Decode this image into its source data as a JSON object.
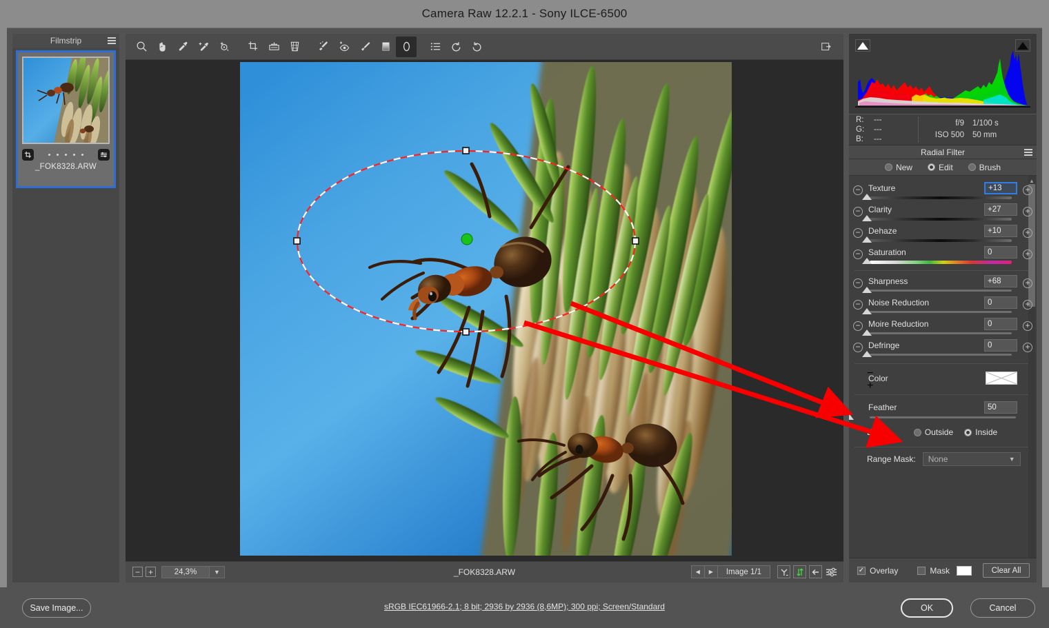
{
  "window": {
    "title": "Camera Raw 12.2.1  -  Sony ILCE-6500"
  },
  "filmstrip": {
    "title": "Filmstrip",
    "menu_icon": "hamburger-icon",
    "thumbnail_filename": "_FOK8328.ARW",
    "crop_badge_icon": "crop-badge-icon",
    "adjust_badge_icon": "adjustment-badge-icon"
  },
  "toolbar": {
    "tools": [
      {
        "name": "zoom-tool",
        "icon": "magnifier-icon",
        "active": false
      },
      {
        "name": "hand-tool",
        "icon": "hand-icon",
        "active": false
      },
      {
        "name": "white-balance-tool",
        "icon": "eyedropper-icon",
        "active": false
      },
      {
        "name": "color-sampler-tool",
        "icon": "color-sampler-icon",
        "active": false
      },
      {
        "name": "targeted-adjustment-tool",
        "icon": "targeted-adjustment-icon",
        "active": false
      },
      {
        "name": "crop-tool",
        "icon": "crop-icon",
        "active": false
      },
      {
        "name": "straighten-tool",
        "icon": "straighten-icon",
        "active": false
      },
      {
        "name": "transform-tool",
        "icon": "transform-grid-icon",
        "active": false
      },
      {
        "name": "spot-removal-tool",
        "icon": "spot-heal-icon",
        "active": false
      },
      {
        "name": "red-eye-tool",
        "icon": "red-eye-icon",
        "active": false
      },
      {
        "name": "adjustment-brush-tool",
        "icon": "brush-icon",
        "active": false
      },
      {
        "name": "graduated-filter-tool",
        "icon": "graduated-filter-icon",
        "active": false
      },
      {
        "name": "radial-filter-tool",
        "icon": "radial-filter-icon",
        "active": true
      },
      {
        "name": "presets-tool",
        "icon": "presets-list-icon",
        "active": false
      },
      {
        "name": "rotate-ccw-tool",
        "icon": "rotate-counterclockwise-icon",
        "active": false
      },
      {
        "name": "rotate-cw-tool",
        "icon": "rotate-clockwise-icon",
        "active": false
      }
    ],
    "fullscreen_icon": "fullscreen-toggle-icon"
  },
  "statusbar": {
    "zoom_out_label": "−",
    "zoom_in_label": "+",
    "zoom_value": "24,3%",
    "filename": "_FOK8328.ARW",
    "prev_label": "◀",
    "next_label": "▶",
    "image_counter": "Image 1/1",
    "icons": [
      {
        "name": "synchronize-icon",
        "glyph": "Y"
      },
      {
        "name": "swap-preview-icon",
        "glyph": "⇅"
      },
      {
        "name": "before-after-icon",
        "glyph": "⬅"
      },
      {
        "name": "preview-settings-icon",
        "glyph": "sliders"
      }
    ]
  },
  "histogram": {
    "shadow_clip_icon": "shadow-clipping-warning-icon",
    "highlight_clip_icon": "highlight-clipping-warning-icon"
  },
  "metadata": {
    "r_label": "R:",
    "r_value": "---",
    "g_label": "G:",
    "g_value": "---",
    "b_label": "B:",
    "b_value": "---",
    "aperture": "f/9",
    "shutter": "1/100 s",
    "iso": "ISO 500",
    "focal_length": "50 mm"
  },
  "panel": {
    "title": "Radial Filter",
    "menu_icon": "panel-menu-icon",
    "modes": [
      {
        "label": "New",
        "selected": false
      },
      {
        "label": "Edit",
        "selected": true
      },
      {
        "label": "Brush",
        "selected": false
      }
    ],
    "sliders_group1": [
      {
        "label": "Texture",
        "value": "+13",
        "pos": 55,
        "track": "dark",
        "focused": true
      },
      {
        "label": "Clarity",
        "value": "+27",
        "pos": 62,
        "track": "dark",
        "focused": false
      },
      {
        "label": "Dehaze",
        "value": "+10",
        "pos": 53,
        "track": "dark",
        "focused": false
      },
      {
        "label": "Saturation",
        "value": "0",
        "pos": 48,
        "track": "rainbow",
        "focused": false
      }
    ],
    "sliders_group2": [
      {
        "label": "Sharpness",
        "value": "+68",
        "pos": 84,
        "track": "flat",
        "focused": false
      },
      {
        "label": "Noise Reduction",
        "value": "0",
        "pos": 48,
        "track": "flat",
        "focused": false
      },
      {
        "label": "Moire Reduction",
        "value": "0",
        "pos": 48,
        "track": "flat",
        "focused": false
      },
      {
        "label": "Defringe",
        "value": "0",
        "pos": 48,
        "track": "flat",
        "focused": false
      }
    ],
    "color": {
      "label": "Color",
      "swatch_icon": "empty-color-swatch-icon"
    },
    "feather": {
      "label": "Feather",
      "value": "50",
      "pos": 48
    },
    "effect": {
      "label": "Effect:",
      "options": [
        {
          "label": "Outside",
          "selected": false
        },
        {
          "label": "Inside",
          "selected": true
        }
      ]
    },
    "range_mask": {
      "label": "Range Mask:",
      "value": "None",
      "caret_icon": "chevron-down-icon"
    },
    "bottom": {
      "overlay_label": "Overlay",
      "overlay_checked": true,
      "mask_label": "Mask",
      "mask_checked": false,
      "clear_all_label": "Clear All"
    }
  },
  "footer": {
    "save_label": "Save Image...",
    "ok_label": "OK",
    "cancel_label": "Cancel",
    "workflow_link": "sRGB IEC61966-2.1; 8 bit; 2936 by 2936 (8,6MP); 300 ppi; Screen/Standard"
  },
  "annotation": {
    "arrow_color": "#f80000",
    "arrow_count": 2
  }
}
